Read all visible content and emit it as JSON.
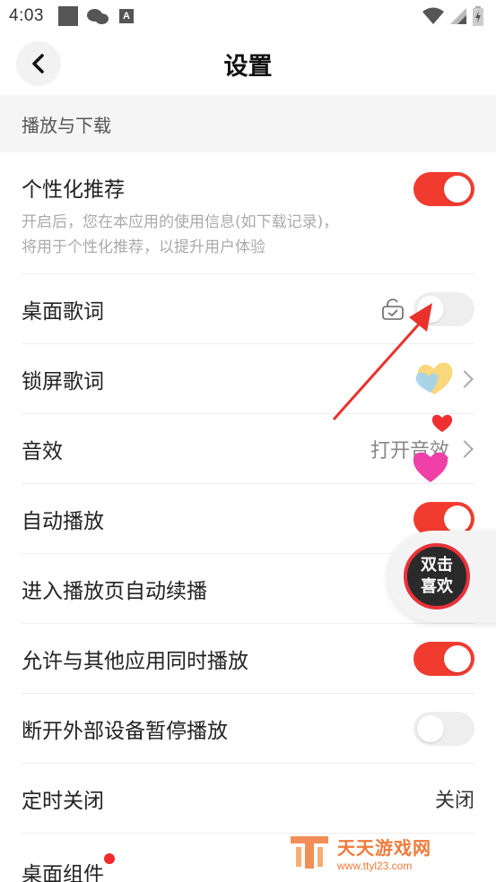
{
  "status_bar": {
    "time": "4:03",
    "icons": [
      "square-notification-icon",
      "wechat-icon",
      "a-notification-icon",
      "wifi-icon",
      "signal-icon",
      "battery-icon"
    ]
  },
  "header": {
    "back_icon": "chevron-left-icon",
    "title": "设置"
  },
  "section": {
    "title": "播放与下载"
  },
  "rows": {
    "personalized": {
      "label": "个性化推荐",
      "desc_line1": "开启后，您在本应用的使用信息(如下载记录)，",
      "desc_line2": "将用于个性化推荐，以提升用户体验",
      "toggle": "on"
    },
    "desktop_lyrics": {
      "label": "桌面歌词",
      "toggle": "off",
      "icon": "lock-check-icon"
    },
    "lockscreen_lyrics": {
      "label": "锁屏歌词"
    },
    "sound_effect": {
      "label": "音效",
      "value": "打开音效"
    },
    "autoplay": {
      "label": "自动播放",
      "toggle": "on"
    },
    "enter_play_page": {
      "label": "进入播放页自动续播"
    },
    "allow_simultaneous": {
      "label": "允许与其他应用同时播放",
      "toggle": "on"
    },
    "disconnect_pause": {
      "label": "断开外部设备暂停播放",
      "toggle": "off"
    },
    "timer_off": {
      "label": "定时关闭",
      "value": "关闭"
    },
    "desktop_widget": {
      "label": "桌面组件"
    }
  },
  "float_like": {
    "line1": "双击",
    "line2": "喜欢"
  },
  "watermark": {
    "main": "天天游戏网",
    "sub": "www.ttyl23.com"
  },
  "colors": {
    "accent": "#f23b2f",
    "toggle_off": "#eeeeee",
    "arrow": "#e8322a"
  }
}
